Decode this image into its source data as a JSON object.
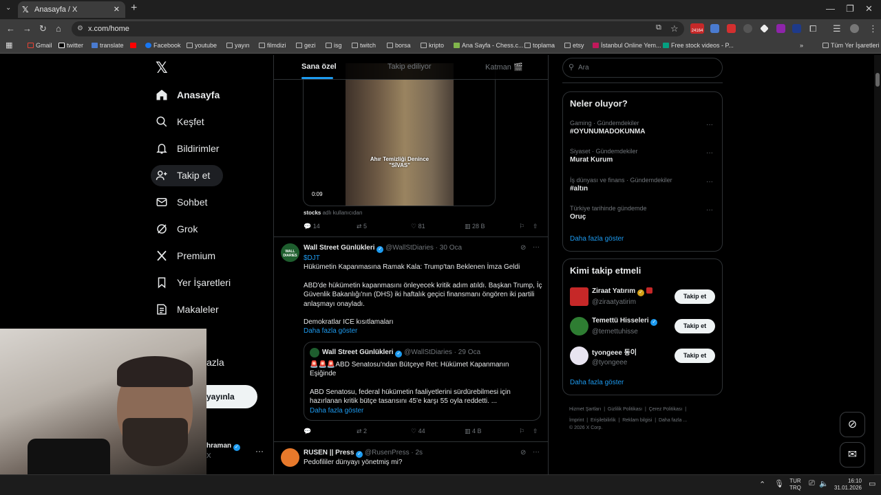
{
  "browser": {
    "tab_title": "Anasayfa / X",
    "url": "x.com/home",
    "bookmarks": [
      "Gmail",
      "twitter",
      "translate",
      "Facebook",
      "youtube",
      "yayın",
      "filmdizi",
      "gezi",
      "isg",
      "twitch",
      "borsa",
      "kripto",
      "Ana Sayfa - Chess.c...",
      "toplama",
      "etsy",
      "İstanbul Online Yem...",
      "Free stock videos - P...",
      "Tüm Yer İşaretleri"
    ],
    "badge_count": "24164"
  },
  "nav": {
    "items": [
      "Anasayfa",
      "Keşfet",
      "Bildirimler",
      "Takip et",
      "Sohbet",
      "Grok",
      "Premium",
      "Yer İşaretleri",
      "Makaleler"
    ],
    "more_partial": "azla",
    "post_partial": "yayınla",
    "account_partial": "hraman",
    "account_handle_partial": "X"
  },
  "feed": {
    "tabs": [
      "Sana özel",
      "Takip ediliyor",
      "Katman 🎬"
    ],
    "video": {
      "caption": "Ahır Temizliği Denince \"SİVAS\"",
      "time": "0:09",
      "source_user": "stocks",
      "source_suffix": "adlı kullanıcıdan"
    },
    "post1_stats": {
      "replies": "14",
      "reposts": "5",
      "likes": "81",
      "views": "28 B"
    },
    "post2": {
      "name": "Wall Street Günlükleri",
      "handle": "@WallStDiaries · 30 Oca",
      "avatar_text": "WALL DIARIES",
      "cashtag": "$DJT",
      "line1": "Hükümetin Kapanmasına Ramak Kala: Trump'tan Beklenen İmza Geldi",
      "para": "ABD'de hükümetin kapanmasını önleyecek kritik adım atıldı. Başkan Trump, İç Güvenlik Bakanlığı'nın (DHS) iki haftalık geçici finansmanı öngören iki partili anlaşmayı onayladı.",
      "line3": "Demokratlar ICE kısıtlamaları",
      "more": "Daha fazla göster",
      "quote": {
        "name": "Wall Street Günlükleri",
        "handle": "@WallStDiaries · 29 Oca",
        "title": "🚨🚨🚨ABD Senatosu'ndan Bütçeye Ret: Hükümet Kapanmanın Eşiğinde",
        "body": "ABD Senatosu, federal hükümetin faaliyetlerini sürdürebilmesi için hazırlanan kritik bütçe tasarısını 45'e karşı 55 oyla reddetti. ...",
        "more": "Daha fazla göster"
      },
      "stats": {
        "replies": "",
        "reposts": "2",
        "likes": "44",
        "views": "4 B"
      }
    },
    "post3": {
      "name": "RUSEN || Press",
      "handle": "@RusenPress · 2s",
      "text": "Pedofililer dünyayı yönetmiş mi?"
    }
  },
  "sidebar": {
    "search_placeholder": "Ara",
    "trends_title": "Neler oluyor?",
    "trends": [
      {
        "meta": "Gaming · Gündemdekiler",
        "title": "#OYUNUMADOKUNMA"
      },
      {
        "meta": "Siyaset · Gündemdekiler",
        "title": "Murat Kurum"
      },
      {
        "meta": "İş dünyası ve finans · Gündemdekiler",
        "title": "#altın"
      },
      {
        "meta": "Türkiye tarihinde gündemde",
        "title": "Oruç"
      }
    ],
    "trends_more": "Daha fazla göster",
    "who_title": "Kimi takip etmeli",
    "who": [
      {
        "name": "Ziraat Yatırım",
        "handle": "@ziraatyatirim"
      },
      {
        "name": "Temettü Hisseleri",
        "handle": "@temettuhisse"
      },
      {
        "name": "tyongeee 동이",
        "handle": "@tyongeee"
      }
    ],
    "follow_label": "Takip et",
    "who_more": "Daha fazla göster",
    "footer": [
      "Hizmet Şartları",
      "|",
      "Gizlilik Politikası",
      "|",
      "Çerez Politikası",
      "|",
      "İmprint",
      "|",
      "Erişilebilirlik",
      "|",
      "Reklam bilgisi",
      "|",
      "Daha fazla ...",
      "© 2026 X Corp."
    ]
  },
  "taskbar": {
    "lang": "TUR",
    "lang2": "TRQ",
    "time": "16:10",
    "date": "31.01.2026"
  },
  "colors": {
    "accent": "#1d9bf0",
    "bg": "#000000",
    "border": "#2f3336",
    "muted": "#71767b"
  }
}
